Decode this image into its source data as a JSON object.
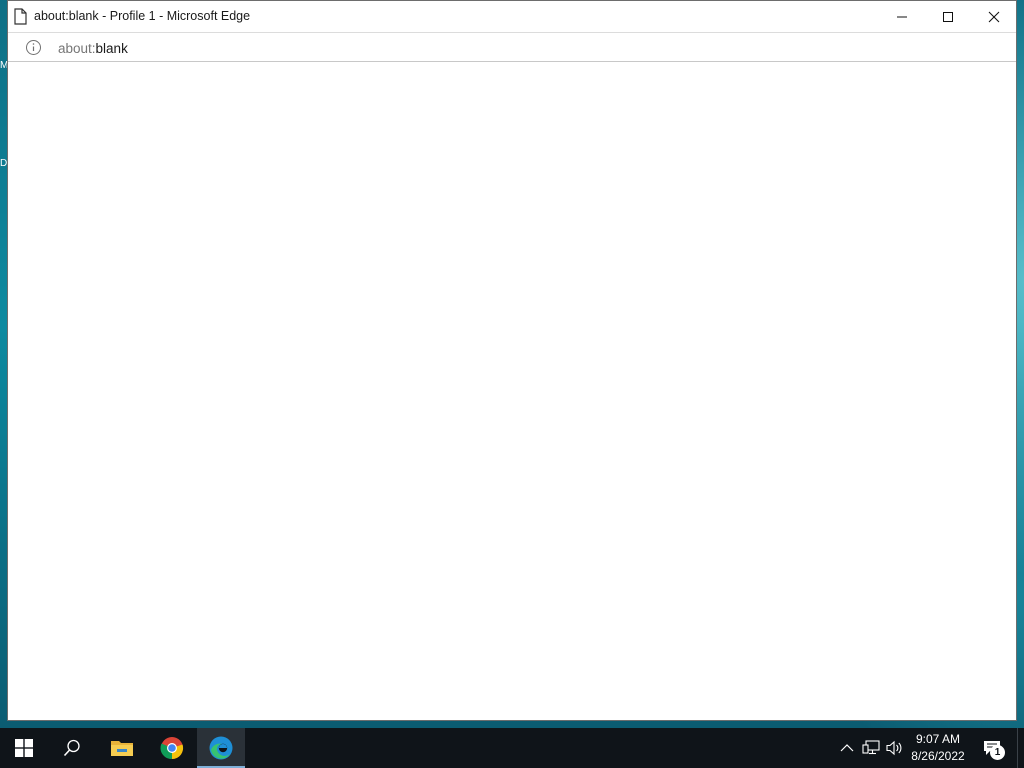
{
  "window": {
    "title": "about:blank - Profile 1 - Microsoft Edge",
    "page_icon": "page-icon",
    "controls": {
      "minimize": "minimize-icon",
      "maximize": "maximize-icon",
      "close": "close-icon"
    }
  },
  "address_bar": {
    "info_icon": "info-icon",
    "url_scheme": "about:",
    "url_rest": "blank"
  },
  "desktop": {
    "icon_stubs": [
      "M",
      "D"
    ]
  },
  "taskbar": {
    "items": [
      {
        "name": "start",
        "icon": "windows-logo-icon"
      },
      {
        "name": "search",
        "icon": "search-icon"
      },
      {
        "name": "file-explorer",
        "icon": "folder-icon"
      },
      {
        "name": "chrome",
        "icon": "chrome-icon"
      },
      {
        "name": "edge",
        "icon": "edge-icon",
        "active": true
      }
    ],
    "tray": {
      "icons": [
        "chevron-up-icon",
        "network-icon",
        "volume-icon"
      ],
      "time": "9:07 AM",
      "date": "8/26/2022",
      "notification_count": "1"
    }
  },
  "colors": {
    "taskbar_bg": "#0f1419",
    "wallpaper": "#0d8aa0",
    "edge_blue": "#1e8fd6",
    "edge_green": "#37c371"
  }
}
